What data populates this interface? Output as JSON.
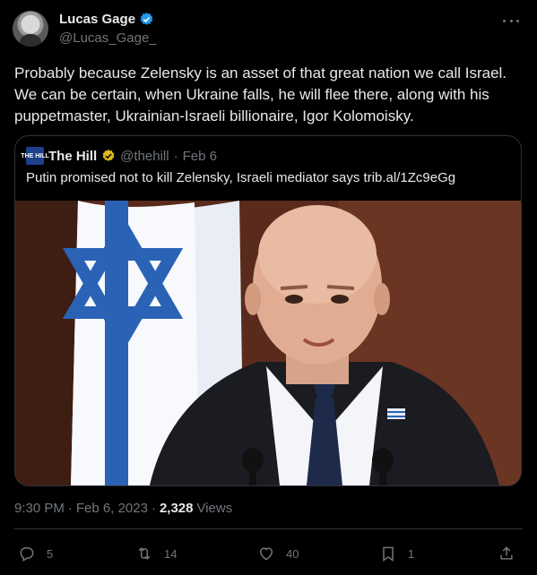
{
  "author": {
    "display_name": "Lucas Gage",
    "handle": "@Lucas_Gage_"
  },
  "tweet": {
    "text": "Probably because Zelensky is an asset of that great nation we call Israel. We can be certain, when Ukraine falls, he will flee there, along with his puppetmaster, Ukrainian-Israeli billionaire, Igor Kolomoisky.",
    "time": "9:30 PM",
    "separator": "·",
    "date": "Feb 6, 2023",
    "views_count": "2,328",
    "views_label": "Views"
  },
  "quoted": {
    "logo_text": "THE HILL",
    "display_name": "The Hill",
    "handle": "@thehill",
    "separator": "·",
    "date": "Feb 6",
    "text": "Putin promised not to kill Zelensky, Israeli mediator says trib.al/1Zc9eGg"
  },
  "actions": {
    "replies": "5",
    "retweets": "14",
    "likes": "40",
    "bookmarks": "1"
  },
  "colors": {
    "background": "#000000",
    "text": "#e7e9ea",
    "muted": "#71767b",
    "border": "#2f3336",
    "verified_blue": "#1d9bf0",
    "verified_gold": "#e2b719"
  },
  "icons": [
    "verified-badge-icon",
    "more-icon",
    "reply-icon",
    "retweet-icon",
    "like-icon",
    "bookmark-icon",
    "share-icon"
  ]
}
